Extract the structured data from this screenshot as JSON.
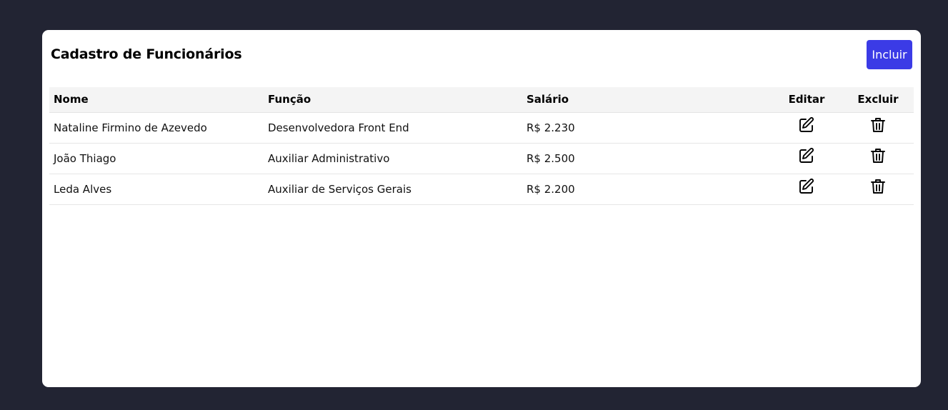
{
  "header": {
    "title": "Cadastro de Funcionários",
    "add_label": "Incluir"
  },
  "table": {
    "columns": [
      "Nome",
      "Função",
      "Salário",
      "Editar",
      "Excluir"
    ],
    "rows": [
      {
        "nome": "Nataline Firmino de Azevedo",
        "funcao": "Desenvolvedora Front End",
        "salario": "R$ 2.230"
      },
      {
        "nome": "João Thiago",
        "funcao": "Auxiliar Administrativo",
        "salario": "R$ 2.500"
      },
      {
        "nome": "Leda Alves",
        "funcao": "Auxiliar de Serviços Gerais",
        "salario": "R$ 2.200"
      }
    ]
  },
  "icons": {
    "edit": "edit-icon",
    "delete": "trash-icon"
  },
  "colors": {
    "background": "#222433",
    "accent": "#3b3be6",
    "header_row": "#f4f4f4"
  }
}
